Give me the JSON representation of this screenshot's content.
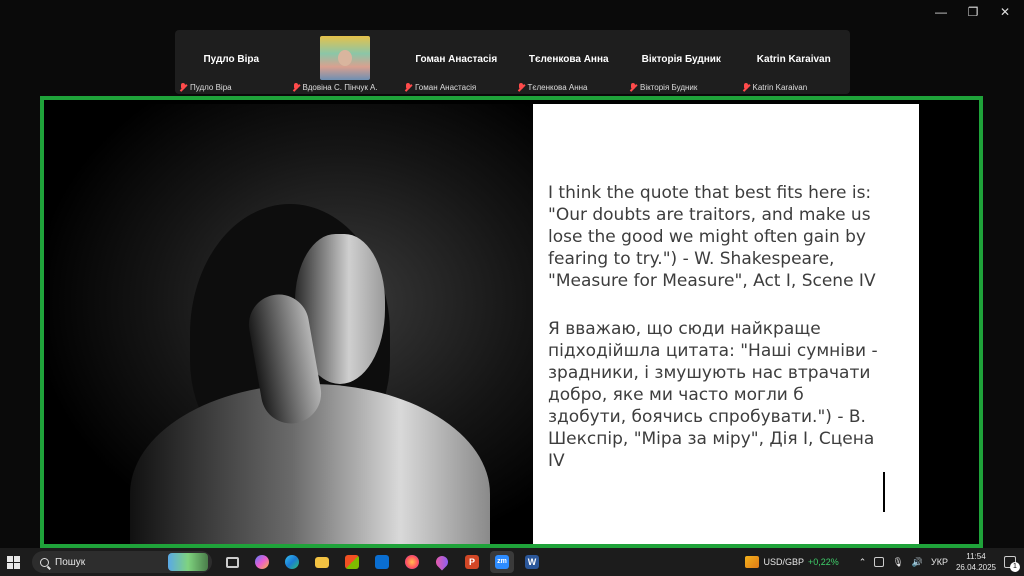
{
  "window_controls": [
    "—",
    "❐",
    "✕"
  ],
  "participants": [
    {
      "display_name": "Пудло Віра",
      "label": "Пудло Віра",
      "video": false
    },
    {
      "display_name": "",
      "label": "Вдовіна С. Пінчук А.",
      "video": true
    },
    {
      "display_name": "Гоман Анастасія",
      "label": "Гоман Анастасія",
      "video": false
    },
    {
      "display_name": "Тєленкова Анна",
      "label": "Тєленкова Анна",
      "video": false
    },
    {
      "display_name": "Вікторія Будник",
      "label": "Вікторія Будник",
      "video": false
    },
    {
      "display_name": "Katrin Karaivan",
      "label": "Katrin Karaivan",
      "video": false
    }
  ],
  "slide": {
    "english": "I think the quote that best fits here is: \"Our doubts are traitors, and make us lose the good we might often gain by fearing to try.\") - W. Shakespeare, \"Measure for Measure\", Act I, Scene IV",
    "ukrainian": "Я вважаю, що сюди найкраще підходійшла цитата: \"Наші сумніви - зрадники, і змушують нас втрачати добро, яке ми часто могли б здобути, боячись спробувати.\") - В. Шекспір, \"Міра за міру\", Дія І, Сцена IV"
  },
  "taskbar": {
    "search_placeholder": "Пошук",
    "apps": [
      "task-view",
      "copilot",
      "edge",
      "file-explorer",
      "store",
      "outlook",
      "firefox",
      "maps",
      "powerpoint",
      "zoom",
      "word"
    ],
    "zoom_label": "zm",
    "word_label": "W",
    "powerpoint_label": "P",
    "stock_symbol": "USD/GBP",
    "stock_change": "+0,22%",
    "language": "УКР",
    "time": "11:54",
    "date": "26.04.2025",
    "notification_count": "1"
  },
  "colors": {
    "share_border": "#1fa33a",
    "muted_mic": "#ff4b4b",
    "stock_positive": "#3fcf6a"
  }
}
